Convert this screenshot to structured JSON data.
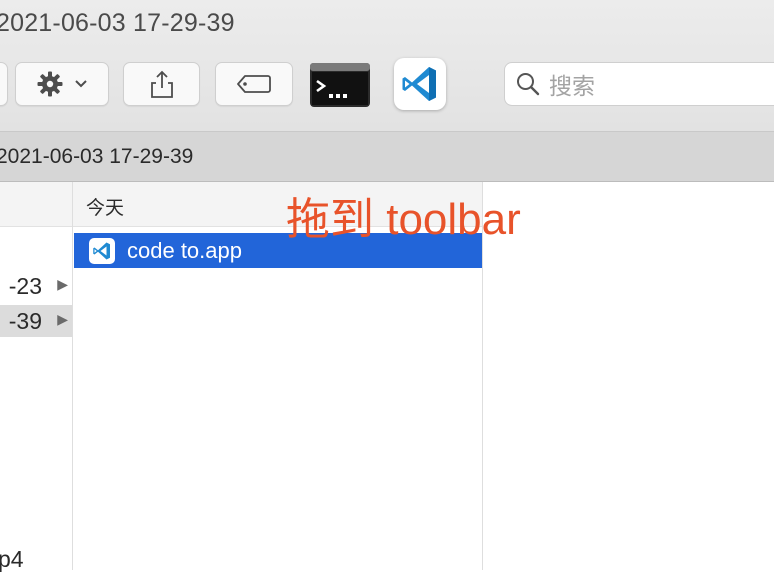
{
  "window": {
    "title": "2021-06-03 17-29-39"
  },
  "toolbar": {
    "action_icon": "gear-icon",
    "share_icon": "share-icon",
    "tag_icon": "tag-icon",
    "terminal_icon": "terminal-app-icon",
    "vscode_icon": "vscode-app-icon"
  },
  "search": {
    "placeholder": "搜索"
  },
  "pathbar": {
    "title": "2021-06-03 17-29-39"
  },
  "column1": {
    "rows": [
      {
        "label": "-23",
        "selected": false
      },
      {
        "label": "-39",
        "selected": true
      }
    ],
    "bottom_label": "p4"
  },
  "column2": {
    "header": "今天",
    "items": [
      {
        "name": "code to.app",
        "selected": true
      }
    ]
  },
  "annotation": {
    "text": "拖到 toolbar",
    "color": "#e8532a"
  },
  "colors": {
    "selection": "#2265d9",
    "vscode_blue": "#1f8ad2"
  }
}
